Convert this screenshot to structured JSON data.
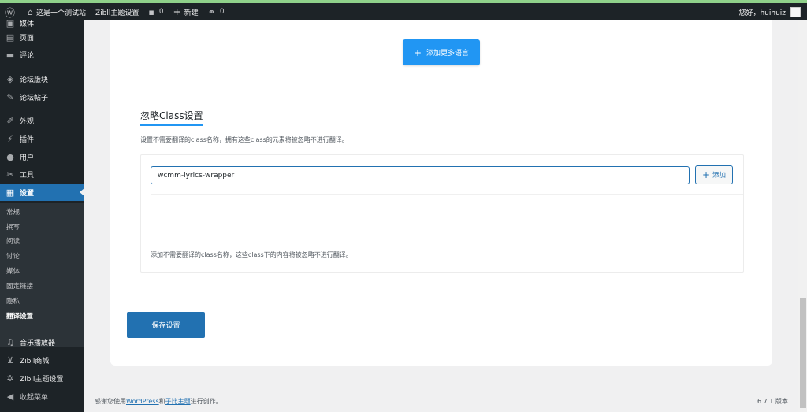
{
  "adminbar": {
    "wp_logo": "wordpress-icon",
    "site_name": "这是一个测试站",
    "theme_settings": "Zibll主题设置",
    "comments_count": "0",
    "new_label": "新建",
    "links_count": "0",
    "greeting": "您好，huihuiz"
  },
  "sidebar": {
    "items": [
      {
        "label": "媒体",
        "icon": "media-icon"
      },
      {
        "label": "页面",
        "icon": "page-icon"
      },
      {
        "label": "评论",
        "icon": "comment-icon"
      },
      {
        "label": "论坛版块",
        "icon": "forum-block-icon"
      },
      {
        "label": "论坛帖子",
        "icon": "forum-post-icon"
      },
      {
        "label": "外观",
        "icon": "appearance-icon"
      },
      {
        "label": "插件",
        "icon": "plugin-icon"
      },
      {
        "label": "用户",
        "icon": "user-icon"
      },
      {
        "label": "工具",
        "icon": "tools-icon"
      },
      {
        "label": "设置",
        "icon": "settings-icon"
      }
    ],
    "submenu": [
      "常规",
      "撰写",
      "阅读",
      "讨论",
      "媒体",
      "固定链接",
      "隐私",
      "翻译设置"
    ],
    "bottom_items": [
      {
        "label": "音乐播放器",
        "icon": "music-icon"
      },
      {
        "label": "Zibll商城",
        "icon": "cart-icon"
      },
      {
        "label": "Zibll主题设置",
        "icon": "gear-icon"
      },
      {
        "label": "收起菜单",
        "icon": "collapse-icon"
      }
    ]
  },
  "main": {
    "add_language_button": "添加更多语言",
    "section_title": "忽略Class设置",
    "section_desc": "设置不需要翻译的class名称，拥有这些class的元素将被忽略不进行翻译。",
    "class_input_value": "wcmm-lyrics-wrapper",
    "add_button": "添加",
    "help_text": "添加不需要翻译的class名称，这些class下的内容将被忽略不进行翻译。",
    "save_button": "保存设置"
  },
  "footer": {
    "text_before": "感谢您使用",
    "wordpress_link": "WordPress",
    "text_and": "和",
    "theme_link": "子比主题",
    "text_after": "进行创作。",
    "version": "6.7.1 版本"
  },
  "colors": {
    "accent": "#2271b1",
    "button_blue": "#2196f3",
    "sidebar_bg": "#1d2327"
  }
}
